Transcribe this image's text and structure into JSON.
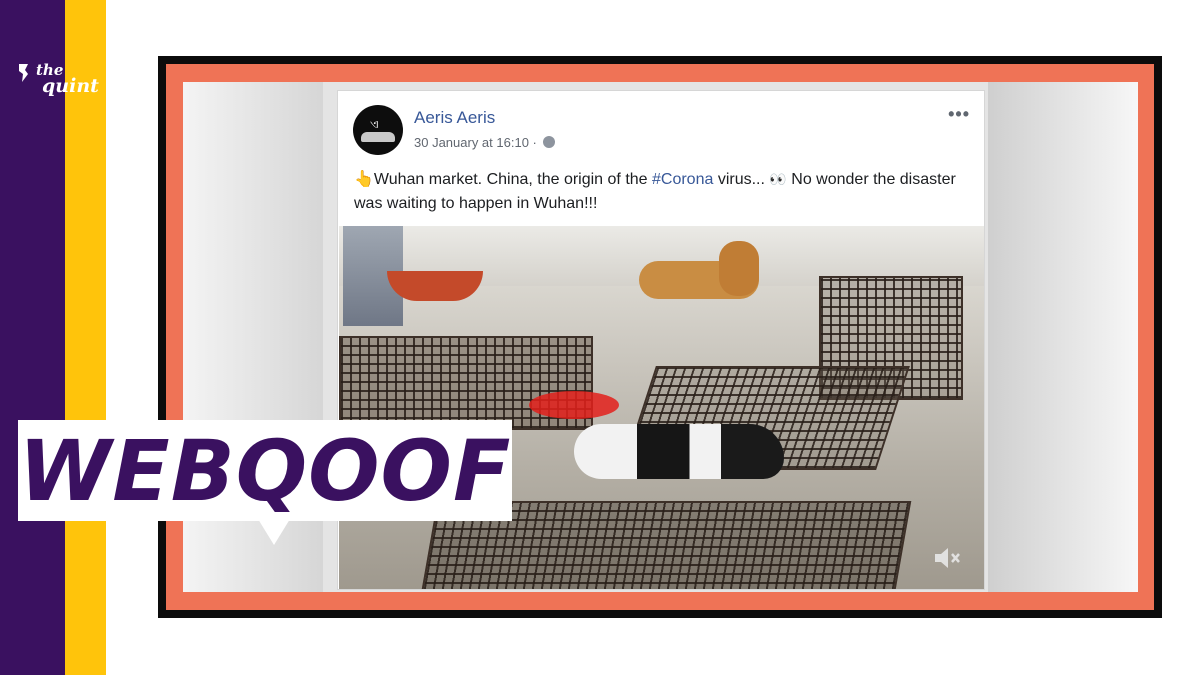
{
  "brand": {
    "logo_line1": "the",
    "logo_line2": "quint",
    "colors": {
      "purple": "#3a1160",
      "yellow": "#ffc40b",
      "orange_frame": "#ef7356"
    }
  },
  "post": {
    "author": "Aeris Aeris",
    "timestamp": "30 January at 16:10 · ",
    "text_emoji": "👆",
    "text_part1": "Wuhan market. China, the origin of the ",
    "hashtag": "#Corona",
    "text_part2": " virus... ",
    "eyes_emoji": "👀",
    "text_part3": " No wonder the disaster was waiting to happen in Wuhan!!!",
    "icons": {
      "privacy": "globe-icon",
      "options": "more-options-icon",
      "volume": "volume-muted-icon"
    }
  },
  "overlay": {
    "label": "WEBQOOF"
  }
}
